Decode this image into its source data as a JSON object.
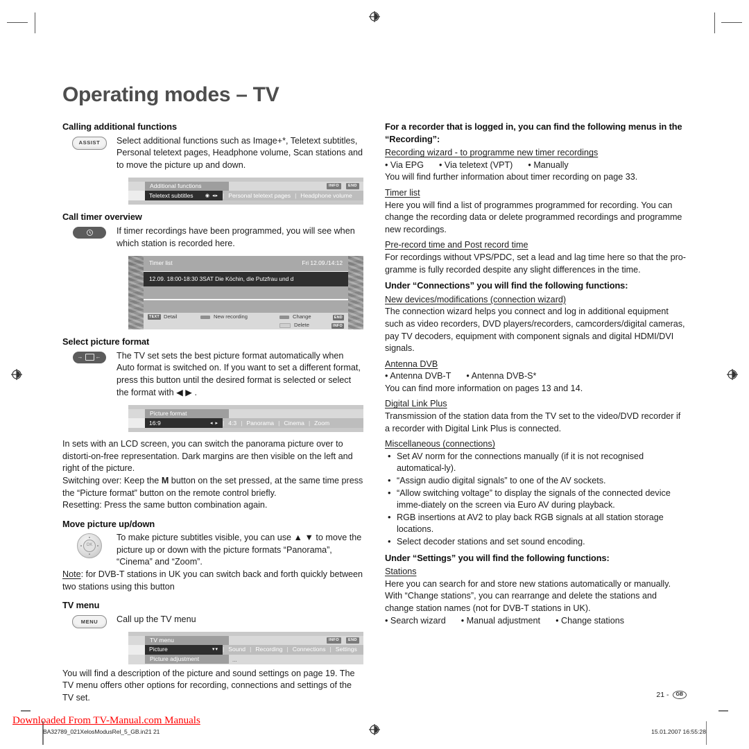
{
  "page_title": "Operating modes – TV",
  "left_column": {
    "sections": [
      {
        "heading": "Calling additional functions",
        "key": "ASSIST",
        "body": "Select additional functions such as Image+*, Teletext subtitles, Personal teletext pages, Headphone volume, Scan stations and to move the picture up and down."
      },
      {
        "heading": "Call timer overview",
        "key": "clock-icon",
        "body": "If timer recordings have been programmed, you will see when which station is recorded here."
      },
      {
        "heading": "Select picture format",
        "key": "picture-format-icon",
        "body": "The TV set sets the best picture format automatically when Auto format is switched on. If you want to set a different format, press this button until the desired format is selected or select the format with ◀ ▶ ."
      },
      {
        "heading": "Move picture up/down",
        "key": "ok-ring-icon",
        "body": "To make picture subtitles visible, you can use ▲ ▼ to move the picture up or down with the picture formats “Panorama”, “Cinema” and “Zoom”."
      },
      {
        "heading": "TV menu",
        "key": "MENU",
        "body": "Call up the TV menu"
      }
    ],
    "lcd_paragraph_1": "In sets with an LCD screen, you can switch the panorama picture over to distorti-on-free representation. Dark margins are then visible on the left and right of the picture.",
    "lcd_paragraph_2_pre": "Switching over: Keep the ",
    "lcd_paragraph_2_bold": "M",
    "lcd_paragraph_2_post": " button on the set pressed, at the same time press the “Picture format”   button on the remote control briefly.",
    "lcd_paragraph_3": "Resetting: Press the same button combination again.",
    "note_label": "Note",
    "note_text": ": for DVB-T stations in UK you can switch back and forth quickly between two stations using this button",
    "closing_paragraph": "You will find a description of the picture and sound settings on page 19. The TV menu offers other options for recording, connections and settings of the TV set."
  },
  "osd_additional_functions": {
    "title": "Additional functions",
    "selected": "Teletext subtitles",
    "selected_glyph": "◉ ◂▸",
    "items": [
      "Personal teletext pages",
      "Headphone volume"
    ],
    "badges": [
      "INFO",
      "END"
    ]
  },
  "osd_timer_list": {
    "title": "Timer list",
    "date": "Fri 12.09./14:12",
    "entry": "12.09.  18:00-18:30  3SAT   Die Köchin, die Putzfrau und d",
    "keys": [
      {
        "badge": "TEXT",
        "label": "Detail"
      },
      {
        "chip": "dark",
        "label": "New recording"
      },
      {
        "chip": "dark",
        "label": "Change"
      },
      {
        "chip": "light",
        "label": "Delete"
      }
    ],
    "corner_badges": [
      "END",
      "INFO"
    ]
  },
  "osd_picture_format": {
    "title": "Picture format",
    "selected": "16:9",
    "selected_glyph": "◂ ▸",
    "items": [
      "4:3",
      "Panorama",
      "Cinema",
      "Zoom"
    ]
  },
  "osd_tv_menu": {
    "title": "TV menu",
    "selected": "Picture",
    "selected_glyph": "▾▾",
    "items": [
      "Sound",
      "Recording",
      "Connections",
      "Settings"
    ],
    "submenu": "Picture adjustment",
    "submenu_dots": "...",
    "badges": [
      "INFO",
      "END"
    ]
  },
  "right_column": {
    "heading_recording": "For a recorder that is logged in, you can find the following menus in the “Recording”:",
    "blocks": [
      {
        "subheading": "Recording wizard - to programme new timer recordings",
        "inline_bullets": [
          "Via EPG",
          "Via teletext (VPT)",
          "Manually"
        ],
        "body": "You will find further information about timer recording on page 33."
      },
      {
        "subheading": "Timer list",
        "body": "Here you will find a list of programmes programmed for recording. You can change the recording data or delete programmed recordings and programme new recordings."
      },
      {
        "subheading": "Pre-record time and Post record time",
        "body": "For recordings without VPS/PDC, set a lead and lag time here so that the pro-gramme is fully recorded despite any slight differences in the time."
      }
    ],
    "heading_connections": "Under “Connections” you will find the following functions:",
    "connection_blocks": [
      {
        "subheading": "New devices/modifications (connection wizard)",
        "body": "The connection wizard helps you connect and log in additional equipment such as video recorders, DVD players/recorders, camcorders/digital cameras, pay TV decoders, equipment with component signals and digital HDMI/DVI signals."
      },
      {
        "subheading": "Antenna DVB",
        "inline_bullets": [
          "Antenna DVB-T",
          "Antenna DVB-S*"
        ],
        "body": "You can find more information on pages 13 and 14."
      },
      {
        "subheading": "Digital Link Plus",
        "body": "Transmission of the station data from the TV set to the video/DVD recorder if a recorder with Digital Link Plus is connected."
      }
    ],
    "misc_subheading": "Miscellaneous (connections)",
    "misc_bullets": [
      "Set AV norm for the connections manually (if it is not recognised automatical-ly).",
      "“Assign audio digital signals” to one of the AV sockets.",
      "“Allow switching voltage” to display the signals of the connected device imme-diately on the screen via Euro AV during playback.",
      "RGB insertions at AV2 to play back RGB signals at all station storage locations.",
      "Select decoder stations and set sound encoding."
    ],
    "heading_settings": "Under “Settings” you will find the following functions:",
    "settings_subheading": "Stations",
    "settings_body": "Here you can search for and store new stations automatically or manually. With “Change stations”, you can rearrange and delete the stations and change station names (not for DVB-T stations in UK).",
    "settings_bullets": [
      "Search wizard",
      "Manual adjustment",
      "Change stations"
    ]
  },
  "footer": {
    "page_number": "21 -",
    "locale_badge": "GB",
    "download_banner": "Downloaded From TV-Manual.com Manuals",
    "file_name": "BA32789_021XelosModusRel_5_GB.in21   21",
    "timestamp": "15.01.2007   16:55:28"
  }
}
